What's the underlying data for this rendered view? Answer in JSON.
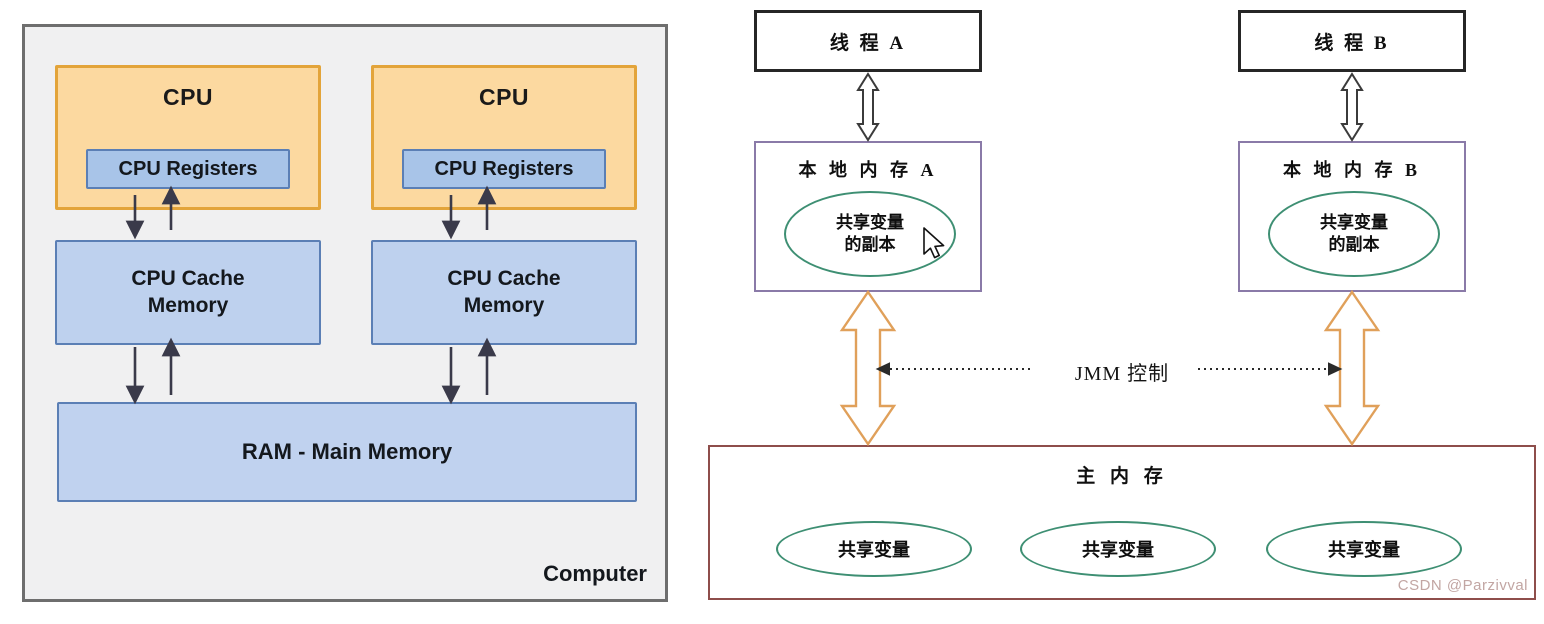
{
  "left_diagram": {
    "container_label": "Computer",
    "cpus": [
      {
        "title": "CPU",
        "registers_label": "CPU Registers",
        "cache_label": "CPU Cache\nMemory",
        "cache_line1": "CPU Cache",
        "cache_line2": "Memory"
      },
      {
        "title": "CPU",
        "registers_label": "CPU Registers",
        "cache_label": "CPU Cache\nMemory",
        "cache_line1": "CPU Cache",
        "cache_line2": "Memory"
      }
    ],
    "ram_label": "RAM - Main Memory",
    "colors": {
      "cpu_fill": "#fcd9a0",
      "cpu_border": "#e3a43a",
      "register_fill": "#a8c4e8",
      "cache_fill": "#bed1ee",
      "ram_fill": "#c0d2ef",
      "blue_border": "#5b7fb5",
      "panel_fill": "#f0f0f1",
      "panel_border": "#6e6e6e",
      "arrow": "#3a3a4a"
    }
  },
  "right_diagram": {
    "threads": [
      {
        "label": "线 程 A"
      },
      {
        "label": "线 程 B"
      }
    ],
    "local_memories": [
      {
        "title": "本 地 内 存 A",
        "copy_line1": "共享变量",
        "copy_line2": "的副本"
      },
      {
        "title": "本 地 内 存 B",
        "copy_line1": "共享变量",
        "copy_line2": "的副本"
      }
    ],
    "jmm_control_label": "JMM 控制",
    "main_memory": {
      "title": "主 内 存",
      "variables": [
        {
          "label": "共享变量"
        },
        {
          "label": "共享变量"
        },
        {
          "label": "共享变量"
        }
      ]
    },
    "colors": {
      "thread_border": "#262626",
      "local_mem_border": "#8a7aa8",
      "ellipse_border": "#3e8f73",
      "main_mem_border": "#8e4e4b",
      "hollow_arrow_dark": "#3b3b3b",
      "hollow_arrow_orange": "#e0a05a",
      "dotted_line": "#2a2a2a"
    }
  },
  "watermark": {
    "text": "CSDN @Parzivval"
  },
  "cursor": {
    "name": "mouse-pointer"
  }
}
